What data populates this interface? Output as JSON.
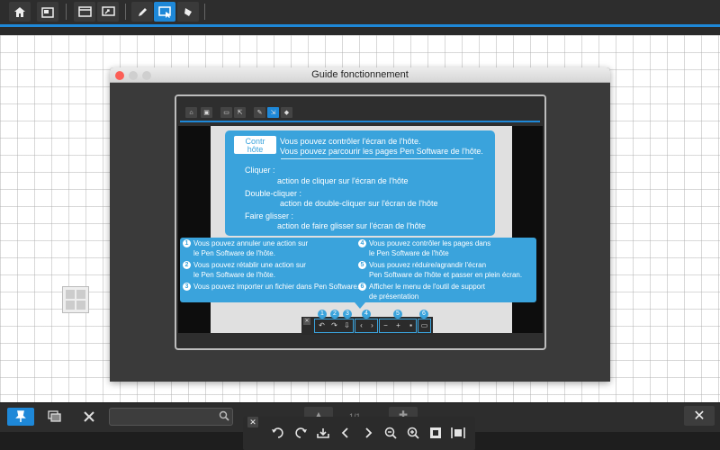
{
  "window": {
    "title": "Guide fonctionnement"
  },
  "toolbar": {
    "buttons": [
      {
        "name": "home-icon"
      },
      {
        "name": "slides-icon"
      },
      {
        "name": "window-icon"
      },
      {
        "name": "screen-share-icon"
      },
      {
        "name": "pen-icon"
      },
      {
        "name": "remote-control-icon",
        "active": true
      },
      {
        "name": "eraser-icon"
      }
    ]
  },
  "guide": {
    "chip_label": "Contr hôte",
    "chip_line1": "Contr",
    "chip_line2": "hôte",
    "intro_line1": "Vous pouvez contrôler l'écran de l'hôte.",
    "intro_line2": "Vous pouvez parcourir les pages Pen Software de l'hôte.",
    "click_title": "Cliquer :",
    "click_desc": "action de cliquer sur l'écran de l'hôte",
    "dblclick_title": "Double-cliquer :",
    "dblclick_desc": "action de double-cliquer sur l'écran de l'hôte",
    "drag_title": "Faire glisser :",
    "drag_desc": "action de faire glisser sur l'écran de l'hôte",
    "items": [
      {
        "num": "1",
        "line1": "Vous pouvez annuler une action sur",
        "line2": "le Pen Software de l'hôte."
      },
      {
        "num": "2",
        "line1": "Vous pouvez rétablir une action sur",
        "line2": "le Pen Software de l'hôte."
      },
      {
        "num": "3",
        "line1": "Vous pouvez importer un fichier dans Pen Software.",
        "line2": ""
      },
      {
        "num": "4",
        "line1": "Vous pouvez contrôler les pages dans",
        "line2": "le Pen Software de l'hôte"
      },
      {
        "num": "5",
        "line1": "Vous pouvez réduire/agrandir l'écran",
        "line2": "Pen Software de l'hôte et passer en plein écran."
      },
      {
        "num": "6",
        "line1": "Afficher le menu de l'outil de support",
        "line2": "de présentation"
      }
    ],
    "mini_numbers": [
      "1",
      "2",
      "3",
      "4",
      "5",
      "6"
    ]
  },
  "bottom": {
    "search_placeholder": "",
    "page_indicator": "1/1",
    "close_label": "✕"
  },
  "controls": [
    "undo-icon",
    "redo-icon",
    "import-icon",
    "prev-page-icon",
    "next-page-icon",
    "zoom-out-icon",
    "zoom-in-icon",
    "fit-icon",
    "fullscreen-icon"
  ],
  "colors": {
    "accent": "#1e88d8",
    "callout": "#3aa3dc",
    "toolbar": "#2d2d2d"
  }
}
